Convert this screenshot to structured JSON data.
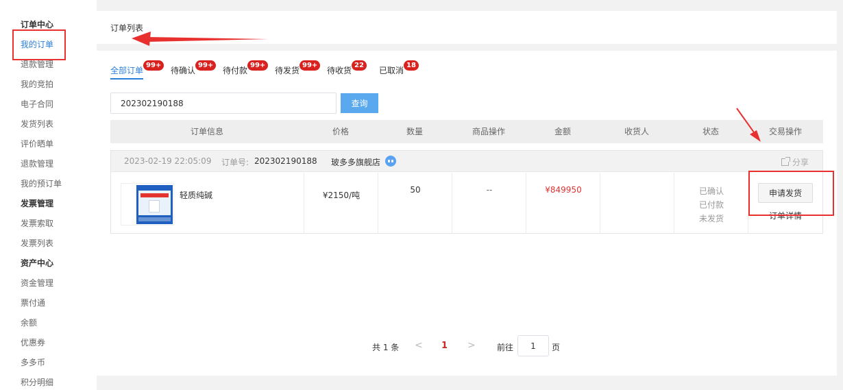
{
  "sidebar": {
    "items": [
      {
        "label": "订单中心",
        "type": "head"
      },
      {
        "label": "我的订单",
        "type": "active"
      },
      {
        "label": "退款管理",
        "type": "item"
      },
      {
        "label": "我的竞拍",
        "type": "item"
      },
      {
        "label": "电子合同",
        "type": "item"
      },
      {
        "label": "发货列表",
        "type": "item"
      },
      {
        "label": "评价晒单",
        "type": "item"
      },
      {
        "label": "退款管理",
        "type": "item"
      },
      {
        "label": "我的预订单",
        "type": "item"
      },
      {
        "label": "发票管理",
        "type": "head"
      },
      {
        "label": "发票索取",
        "type": "item"
      },
      {
        "label": "发票列表",
        "type": "item"
      },
      {
        "label": "资产中心",
        "type": "head"
      },
      {
        "label": "资金管理",
        "type": "item"
      },
      {
        "label": "票付通",
        "type": "item"
      },
      {
        "label": "余额",
        "type": "item"
      },
      {
        "label": "优惠券",
        "type": "item"
      },
      {
        "label": "多多币",
        "type": "item"
      },
      {
        "label": "积分明细",
        "type": "item"
      }
    ]
  },
  "header": {
    "title": "订单列表"
  },
  "tabs": [
    {
      "label": "全部订单",
      "badge": "99+",
      "active": true
    },
    {
      "label": "待确认",
      "badge": "99+"
    },
    {
      "label": "待付款",
      "badge": "99+"
    },
    {
      "label": "待发货",
      "badge": "99+"
    },
    {
      "label": "待收货",
      "badge": "22"
    },
    {
      "label": "已取消",
      "badge": "18"
    }
  ],
  "search": {
    "value": "202302190188",
    "button": "查询"
  },
  "table": {
    "columns": [
      "订单信息",
      "价格",
      "数量",
      "商品操作",
      "金额",
      "收货人",
      "状态",
      "交易操作"
    ]
  },
  "order": {
    "date": "2023-02-19 22:05:09",
    "order_no_label": "订单号:",
    "order_no": "202302190188",
    "shop": "玻多多旗舰店",
    "share": "分享",
    "product_name": "轻质纯碱",
    "price": "¥2150/吨",
    "quantity": "50",
    "product_op": "--",
    "amount": "¥849950",
    "receiver": "",
    "status": [
      "已确认",
      "已付款",
      "未发货"
    ],
    "apply_button": "申请发货",
    "detail_link": "订单详情"
  },
  "pager": {
    "total": "共 1 条",
    "prev": "<",
    "current": "1",
    "next": ">",
    "goto": "前往",
    "goto_value": "1",
    "page_suffix": "页"
  },
  "colors": {
    "accent": "#2b7fd8",
    "badge": "#d8221f",
    "annotation": "#e8312f",
    "amount": "#dd3333"
  }
}
